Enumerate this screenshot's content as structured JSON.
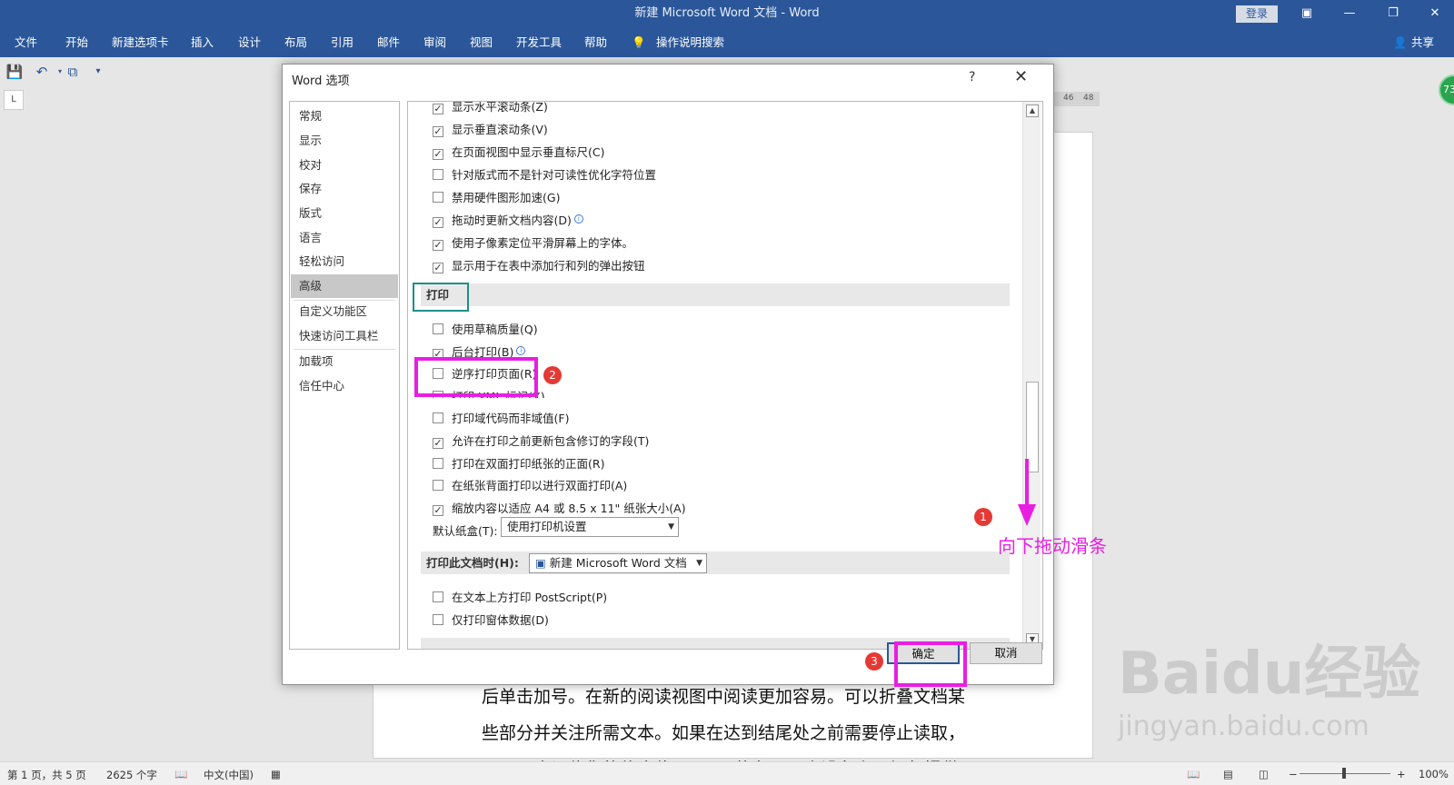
{
  "window": {
    "title": "新建 Microsoft Word 文档  -  Word",
    "login": "登录",
    "share": "共享"
  },
  "ribbon": {
    "tabs": [
      "文件",
      "开始",
      "新建选项卡",
      "插入",
      "设计",
      "布局",
      "引用",
      "邮件",
      "审阅",
      "视图",
      "开发工具",
      "帮助"
    ],
    "search": "操作说明搜索"
  },
  "ruler": {
    "nums": [
      "46",
      "48"
    ]
  },
  "badge": "73",
  "doc": {
    "lines": [
      "后单击加号。在新的阅读视图中阅读更加容易。可以折叠文档某",
      "些部分并关注所需文本。如果在达到结尾处之前需要停止读取，",
      "Word 会记住您的停止位置 — 即使在另一个设备上。视频提供"
    ]
  },
  "status": {
    "page": "第 1 页，共 5 页",
    "words": "2625 个字",
    "lang": "中文(中国)",
    "zoom": "100%"
  },
  "dialog": {
    "title": "Word 选项",
    "help": "?",
    "close": "✕",
    "nav": [
      "常规",
      "显示",
      "校对",
      "保存",
      "版式",
      "语言",
      "轻松访问",
      "高级",
      "自定义功能区",
      "快速访问工具栏",
      "加载项",
      "信任中心"
    ],
    "options_display": [
      {
        "label": "显示水平滚动条(Z)",
        "checked": true
      },
      {
        "label": "显示垂直滚动条(V)",
        "checked": true
      },
      {
        "label": "在页面视图中显示垂直标尺(C)",
        "checked": true
      },
      {
        "label": "针对版式而不是针对可读性优化字符位置",
        "checked": false
      },
      {
        "label": "禁用硬件图形加速(G)",
        "checked": false
      },
      {
        "label": "拖动时更新文档内容(D)",
        "checked": true
      },
      {
        "label": "使用子像素定位平滑屏幕上的字体。",
        "checked": true
      },
      {
        "label": "显示用于在表中添加行和列的弹出按钮",
        "checked": true
      }
    ],
    "print_section": "打印",
    "options_print": [
      {
        "label": "使用草稿质量(Q)",
        "checked": false
      },
      {
        "label": "后台打印(B)",
        "checked": true
      },
      {
        "label": "逆序打印页面(R)",
        "checked": false
      },
      {
        "label": "打印 XML 标记(X)",
        "checked": false
      },
      {
        "label": "打印域代码而非域值(F)",
        "checked": false
      },
      {
        "label": "允许在打印之前更新包含修订的字段(T)",
        "checked": true
      },
      {
        "label": "打印在双面打印纸张的正面(R)",
        "checked": false
      },
      {
        "label": "在纸张背面打印以进行双面打印(A)",
        "checked": false
      },
      {
        "label": "缩放内容以适应 A4 或 8.5 x 11\" 纸张大小(A)",
        "checked": true
      }
    ],
    "tray_label": "默认纸盒(T):",
    "tray_value": "使用打印机设置",
    "print_doc_label": "打印此文档时(H):",
    "print_doc_value": "新建 Microsoft Word 文档",
    "options_doc": [
      {
        "label": "在文本上方打印 PostScript(P)",
        "checked": false
      },
      {
        "label": "仅打印窗体数据(D)",
        "checked": false
      }
    ],
    "ok": "确定",
    "cancel": "取消"
  },
  "annotations": {
    "n1": "1",
    "n2": "2",
    "n3": "3",
    "drag_text": "向下拖动滑条"
  },
  "watermark": {
    "brand": "Baidu经验",
    "url": "jingyan.baidu.com"
  }
}
